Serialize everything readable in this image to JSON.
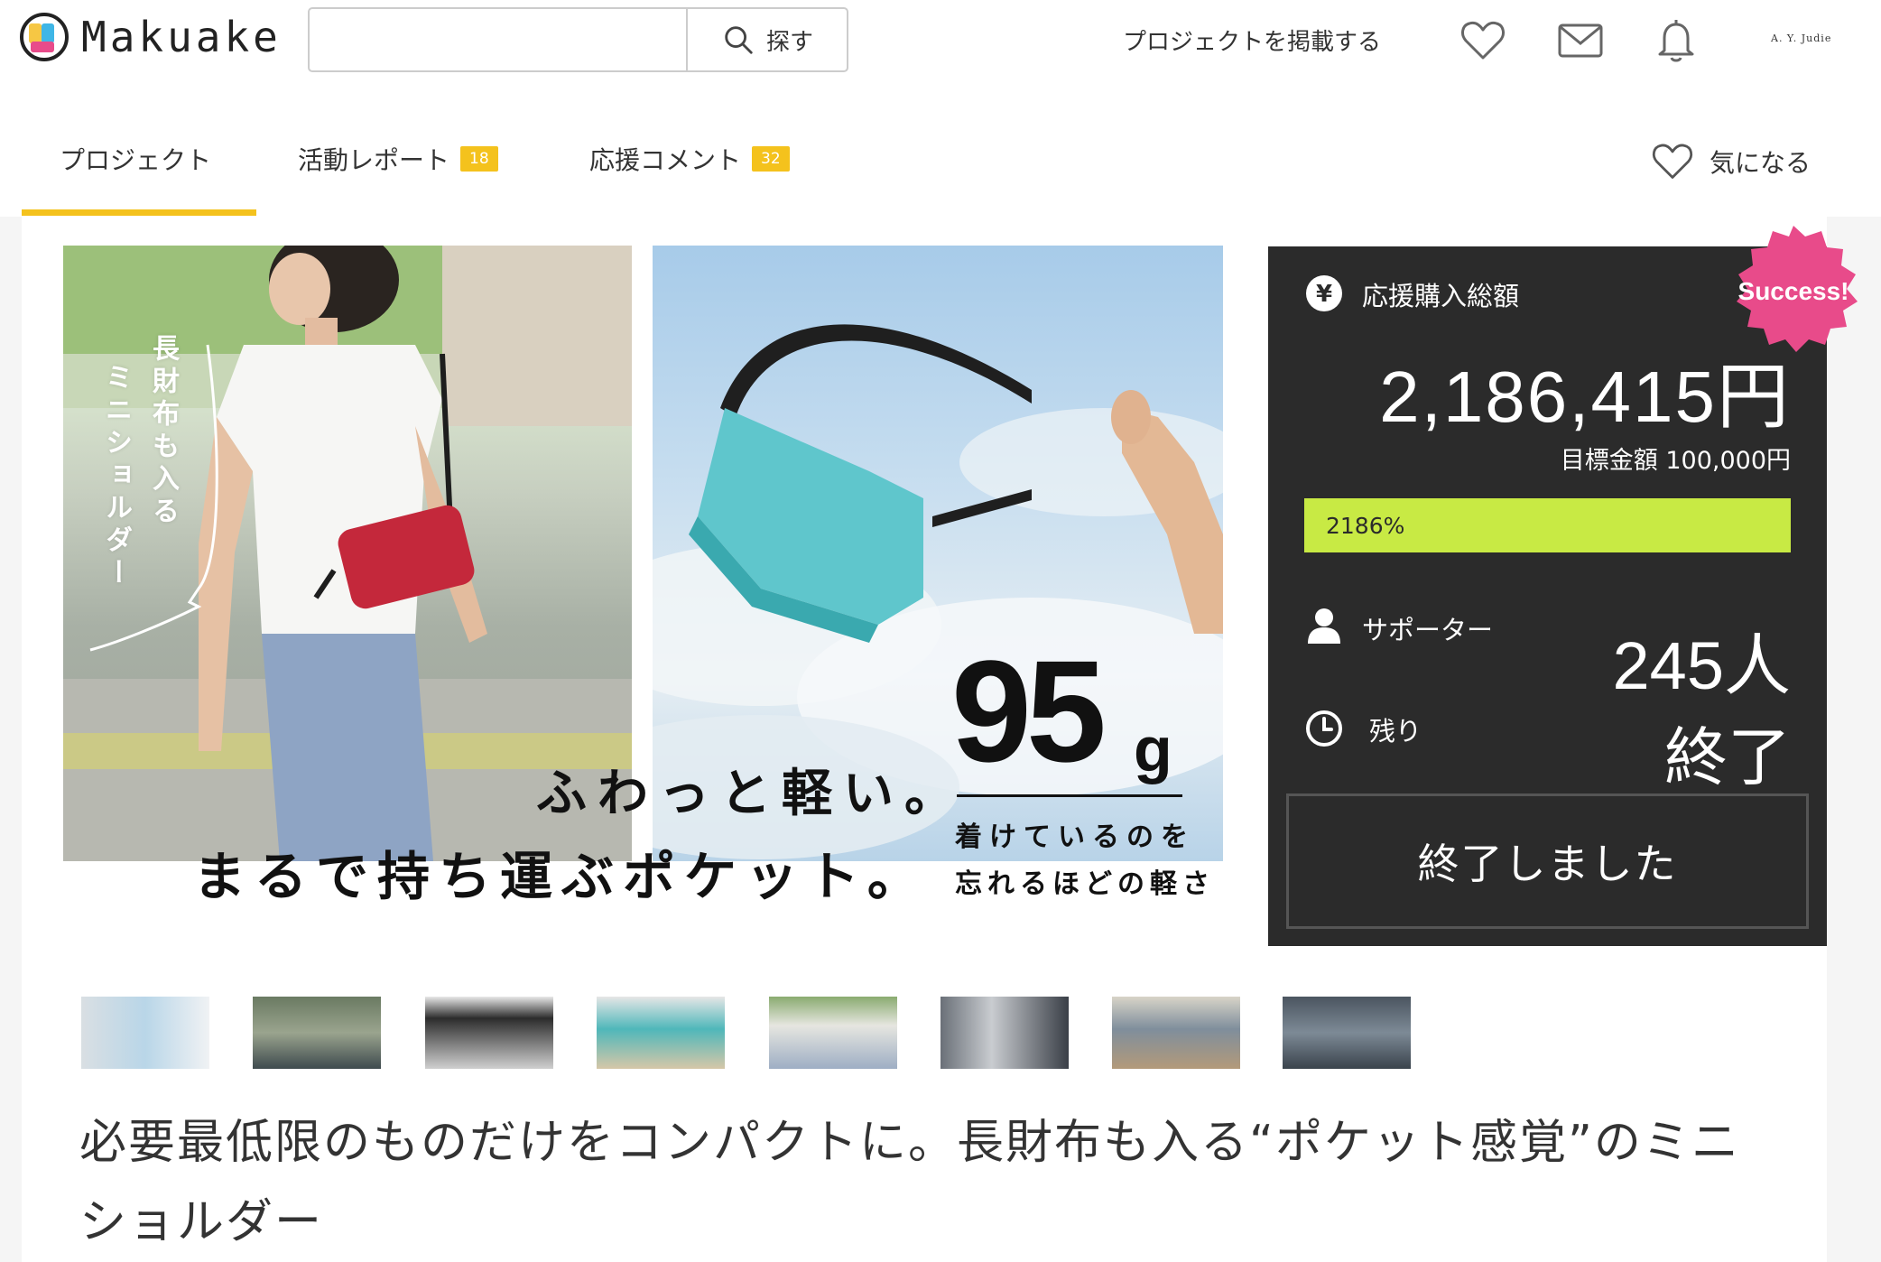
{
  "header": {
    "logo_text": "Makuake",
    "search_placeholder": "",
    "search_button": "探す",
    "post_project": "プロジェクトを掲載する",
    "user_name": "A. Y. Judie",
    "icons": [
      "heart-icon",
      "mail-icon",
      "bell-icon",
      "search-icon"
    ]
  },
  "tabs": [
    {
      "label": "プロジェクト",
      "badge": null,
      "active": true
    },
    {
      "label": "活動レポート",
      "badge": "18"
    },
    {
      "label": "応援コメント",
      "badge": "32"
    }
  ],
  "like_label": "気になる",
  "hero": {
    "vertical_text_1": "長財布も入る",
    "vertical_text_2": "ミニショルダー",
    "weight_number": "95",
    "weight_unit": "g",
    "weight_sub_1": "着けているのを",
    "weight_sub_2": "忘れるほどの軽さ",
    "catch_1": "ふわっと軽い。",
    "catch_2": "まるで持ち運ぶポケット。"
  },
  "stats": {
    "badge": "Success!",
    "total_label": "応援購入総額",
    "total_amount": "2,186,415円",
    "target": "目標金額 100,000円",
    "progress_label": "2186%",
    "progress_percent": 100,
    "supporters_label": "サポーター",
    "supporters_value": "245人",
    "remaining_label": "残り",
    "remaining_value": "終了",
    "end_button": "終了しました"
  },
  "colors": {
    "accent": "#f4c21d",
    "panel_bg": "#2b2b2b",
    "progress": "#c8ea44",
    "success_badge": "#e84b8a"
  },
  "thumbnails_count": 8,
  "title": "必要最低限のものだけをコンパクトに。長財布も入る“ポケット感覚”のミニショルダー"
}
